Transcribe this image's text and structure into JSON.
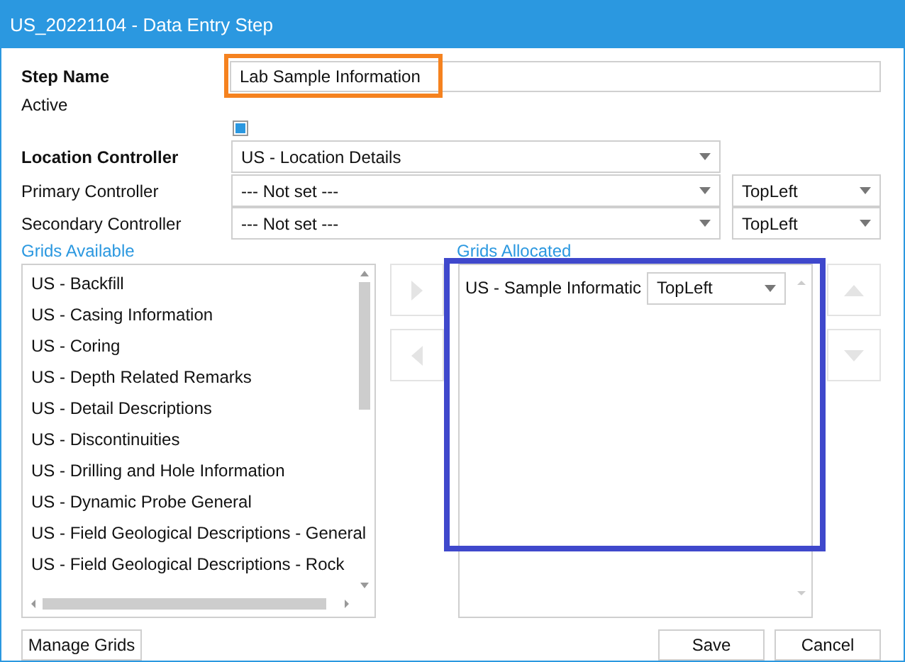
{
  "window": {
    "title": "US_20221104 - Data Entry Step"
  },
  "step_name": {
    "label": "Step Name",
    "value": "Lab Sample Information",
    "highlighted": true
  },
  "active": {
    "label": "Active",
    "checked": true
  },
  "location_controller": {
    "label": "Location Controller",
    "value": "US - Location Details"
  },
  "controllers": [
    {
      "label": "Primary Controller",
      "value": "--- Not set ---",
      "position": "TopLeft"
    },
    {
      "label": "Secondary Controller",
      "value": "--- Not set ---",
      "position": "TopLeft"
    }
  ],
  "grids_available": {
    "label": "Grids Available",
    "items": [
      "US - Backfill",
      "US - Casing Information",
      "US - Coring",
      "US - Depth Related Remarks",
      "US - Detail Descriptions",
      "US - Discontinuities",
      "US - Drilling and Hole Information",
      "US - Dynamic Probe General",
      "US - Field Geological Descriptions - General",
      "US - Field Geological Descriptions - Rock"
    ]
  },
  "grids_allocated": {
    "label": "Grids Allocated",
    "highlighted": true,
    "items": [
      {
        "name": "US - Sample Informatic",
        "position": "TopLeft"
      }
    ]
  },
  "buttons": {
    "manage": "Manage Grids",
    "save": "Save",
    "cancel": "Cancel"
  }
}
